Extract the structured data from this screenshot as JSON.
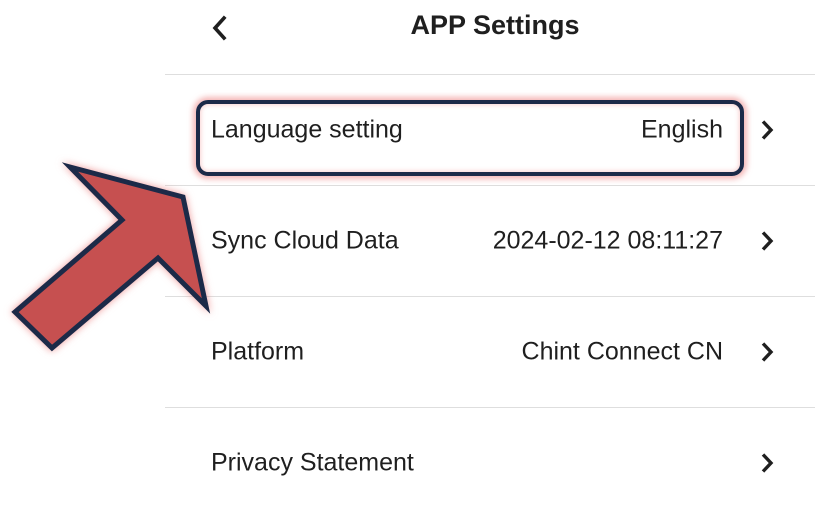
{
  "header": {
    "title": "APP Settings",
    "back_icon": "chevron-left-icon"
  },
  "settings": {
    "items": [
      {
        "label": "Language setting",
        "value": "English",
        "icon": "chevron-right-icon"
      },
      {
        "label": "Sync Cloud Data",
        "value": "2024-02-12 08:11:27",
        "icon": "chevron-right-icon"
      },
      {
        "label": "Platform",
        "value": "Chint Connect CN",
        "icon": "chevron-right-icon"
      },
      {
        "label": "Privacy Statement",
        "value": "",
        "icon": "chevron-right-icon"
      }
    ]
  },
  "annotation": {
    "arrow_fill": "#c65050",
    "arrow_outline": "#1c2a48",
    "highlight_border": "#1c2a48",
    "glow": "#eb7878"
  }
}
